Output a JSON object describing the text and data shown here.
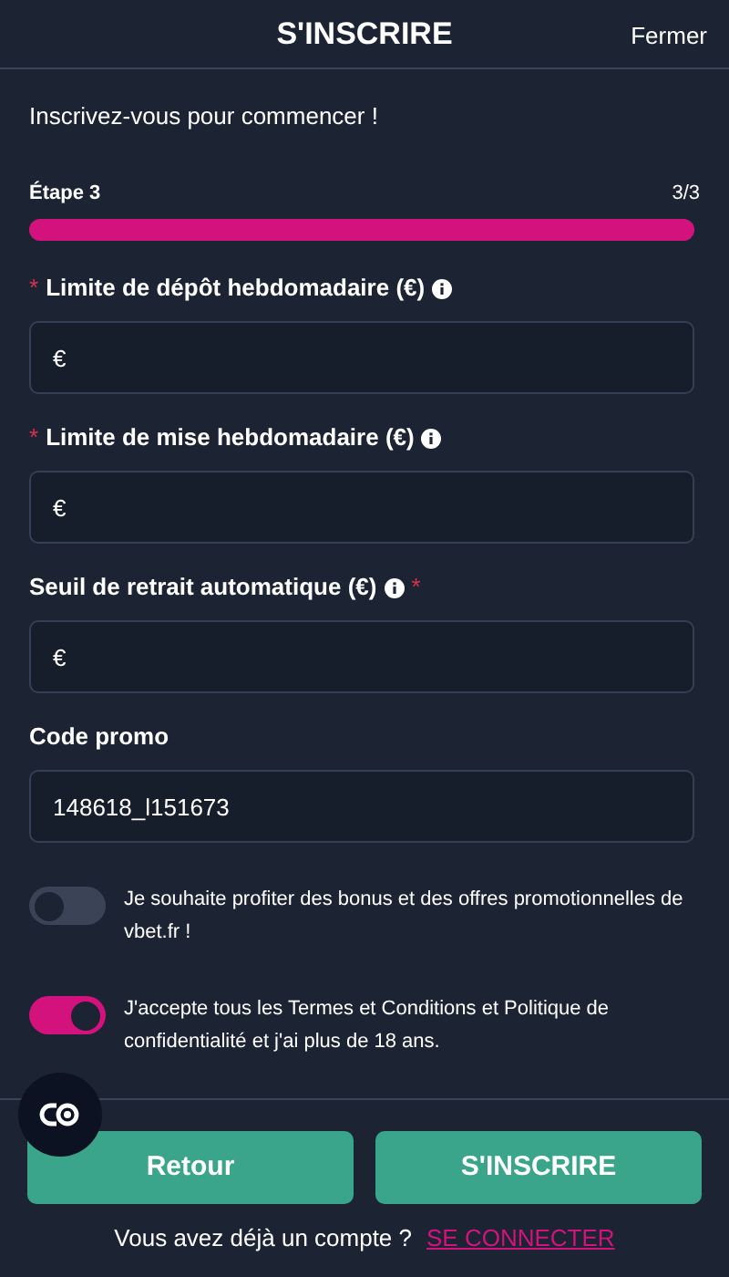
{
  "header": {
    "title": "S'INSCRIRE",
    "close": "Fermer"
  },
  "subtitle": "Inscrivez-vous pour commencer !",
  "step": {
    "label": "Étape 3",
    "count": "3/3",
    "level": 1
  },
  "fields": [
    {
      "label": "Limite de dépôt hebdomadaire (€)",
      "required_mark": "*",
      "mark_after": false,
      "info": true,
      "placeholder": "€"
    },
    {
      "label": "Limite de mise hebdomadaire (€)",
      "required_mark": "*",
      "mark_after": false,
      "info": true,
      "placeholder": "€"
    },
    {
      "label": "Seuil de retrait automatique (€)",
      "required_mark": "*",
      "mark_after": true,
      "info": true,
      "placeholder": "€"
    },
    {
      "label": "Code promo",
      "info": false,
      "value": "148618_l151673"
    }
  ],
  "toggles": [
    {
      "label": "Je souhaite profiter des bonus et des offres promotionnelles de vbet.fr !",
      "on": false
    },
    {
      "label": "J'accepte tous les Termes et Conditions et Politique de confidentialité et j'ai plus de 18 ans.",
      "on": true
    }
  ],
  "buttons": [
    "Retour",
    "S'INSCRIRE"
  ],
  "footer": {
    "text": "Vous avez déjà un compte ?",
    "link": "SE CONNECTER"
  }
}
